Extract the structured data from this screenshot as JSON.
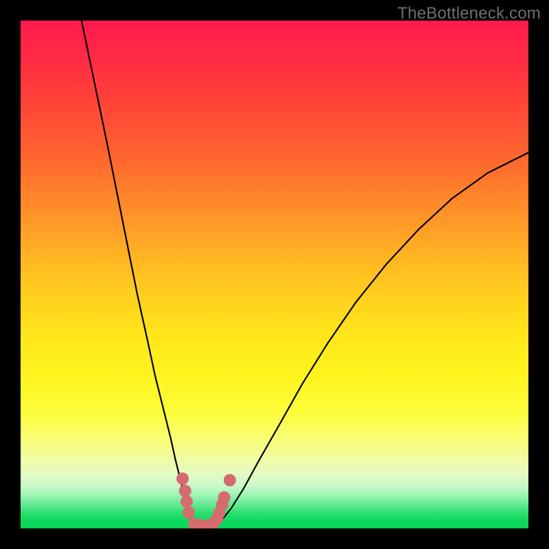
{
  "watermark": "TheBottleneck.com",
  "colors": {
    "frame": "#000000",
    "curve": "#000000",
    "marker": "#d56b6e",
    "gradient_top": "#ff1a4d",
    "gradient_bottom": "#06d657"
  },
  "chart_data": {
    "type": "line",
    "title": "",
    "xlabel": "",
    "ylabel": "",
    "xlim": [
      0,
      100
    ],
    "ylim": [
      0,
      100
    ],
    "note": "Axes are unlabeled in the source image; values are estimated from pixel positions on a 0–100 normalized scale (0 = left/bottom of plot area, 100 = right/top). The left curve descends from top-left toward the trough; the right curve ascends from the trough toward the right edge. Pink markers cluster around the trough.",
    "series": [
      {
        "name": "left-curve",
        "x": [
          12.0,
          14.5,
          17.0,
          19.0,
          21.0,
          23.0,
          25.0,
          26.5,
          28.0,
          29.5,
          30.5,
          31.5,
          32.2,
          32.9,
          33.5,
          34.0,
          34.5
        ],
        "y": [
          100.0,
          88.0,
          76.0,
          66.0,
          56.0,
          46.0,
          37.0,
          30.0,
          24.0,
          18.0,
          13.5,
          9.5,
          6.5,
          4.0,
          2.2,
          1.0,
          0.3
        ]
      },
      {
        "name": "right-curve",
        "x": [
          38.0,
          39.5,
          41.5,
          44.0,
          47.0,
          51.0,
          55.5,
          60.5,
          66.0,
          72.0,
          78.5,
          85.0,
          92.0,
          100.0
        ],
        "y": [
          0.3,
          1.5,
          4.0,
          8.0,
          13.5,
          20.5,
          28.5,
          36.5,
          44.5,
          52.0,
          59.0,
          65.0,
          70.0,
          74.0
        ]
      },
      {
        "name": "trough-markers",
        "type": "scatter",
        "x": [
          31.9,
          32.4,
          32.7,
          33.1,
          34.2,
          35.4,
          36.8,
          37.9,
          38.7,
          39.1,
          39.7,
          40.1,
          41.2
        ],
        "y": [
          9.8,
          7.4,
          5.3,
          3.1,
          0.9,
          0.6,
          0.6,
          0.9,
          1.9,
          3.0,
          4.7,
          6.1,
          9.5
        ]
      }
    ]
  }
}
